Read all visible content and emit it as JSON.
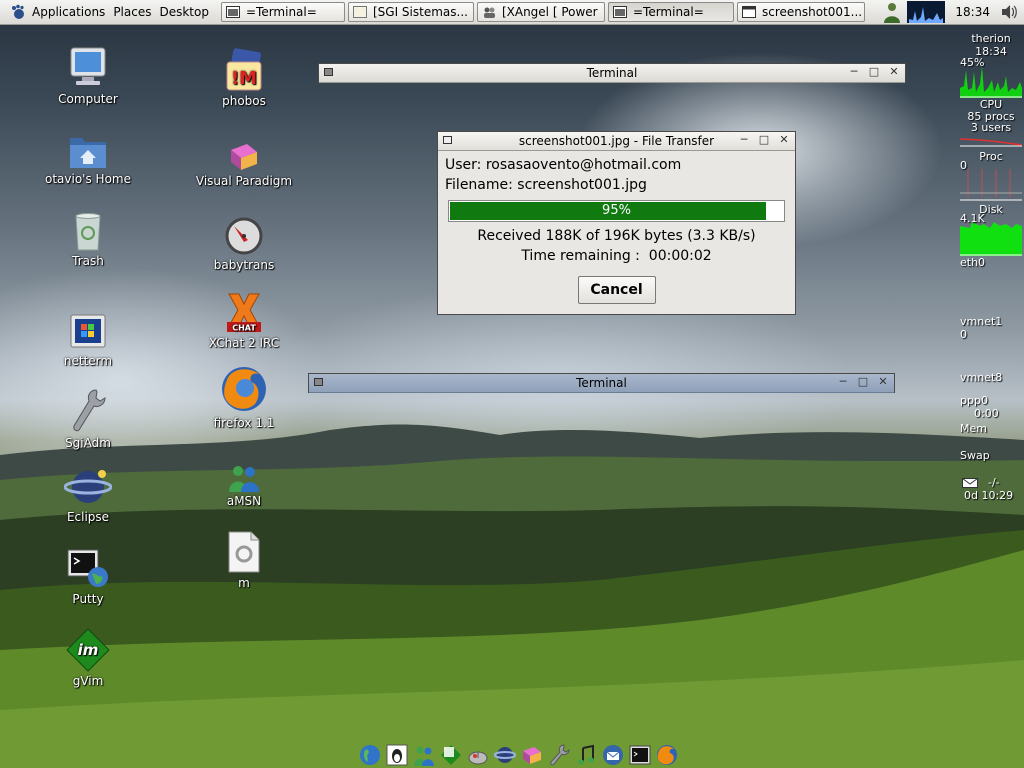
{
  "panel": {
    "applications": "Applications",
    "places": "Places",
    "desktop": "Desktop",
    "tasks": [
      {
        "label": "=Terminal=",
        "icon": "terminal-icon",
        "active": false
      },
      {
        "label": "[SGI Sistemas...",
        "icon": "chat-icon",
        "active": false
      },
      {
        "label": "[XAngel [ Power",
        "icon": "users-icon",
        "active": false
      },
      {
        "label": "=Terminal=",
        "icon": "terminal-icon",
        "active": true
      },
      {
        "label": "screenshot001...",
        "icon": "window-icon",
        "active": false
      }
    ],
    "clock": "18:34"
  },
  "desktop_icons_left": [
    {
      "label": "Computer",
      "icon": "computer-icon"
    },
    {
      "label": "otavio's Home",
      "icon": "home-folder-icon"
    },
    {
      "label": "Trash",
      "icon": "trash-icon"
    },
    {
      "label": "netterm",
      "icon": "netterm-icon"
    },
    {
      "label": "SgiAdm",
      "icon": "wrench-icon"
    },
    {
      "label": "Eclipse",
      "icon": "eclipse-icon"
    },
    {
      "label": "Putty",
      "icon": "putty-icon"
    },
    {
      "label": "gVim",
      "icon": "gvim-icon"
    }
  ],
  "desktop_icons_right": [
    {
      "label": "phobos",
      "icon": "phobos-icon"
    },
    {
      "label": "Visual Paradigm",
      "icon": "visual-paradigm-icon"
    },
    {
      "label": "babytrans",
      "icon": "babytrans-icon"
    },
    {
      "label": "XChat 2 IRC",
      "icon": "xchat-icon"
    },
    {
      "label": "firefox 1.1",
      "icon": "firefox-icon"
    },
    {
      "label": "aMSN",
      "icon": "amsn-icon"
    },
    {
      "label": "m",
      "icon": "document-icon"
    }
  ],
  "terminal_top": {
    "title": "Terminal"
  },
  "terminal_mid": {
    "title": "Terminal"
  },
  "file_transfer": {
    "title": "screenshot001.jpg - File Transfer",
    "user": "User: rosasaovento@hotmail.com",
    "filename": "Filename: screenshot001.jpg",
    "progress_label": "95%",
    "progress_fraction": 0.95,
    "received": "Received 188K of 196K bytes (3.3 KB/s)",
    "time_remaining": "Time remaining :  00:00:02",
    "cancel": "Cancel"
  },
  "monitor": {
    "host": "therion",
    "time": "18:34",
    "cpu_pct": "45%",
    "cpu": "CPU",
    "procs": "85 procs",
    "users": "3 users",
    "proc": "Proc",
    "proc_zero": "0",
    "disk": "Disk",
    "disk_rate": "4.1K",
    "eth0": "eth0",
    "vmnet1": "vmnet1",
    "vmnet1_val": "0",
    "vmnet8": "vmnet8",
    "ppp0": "ppp0",
    "ppp0_time": "0:00",
    "mem": "Mem",
    "swap": "Swap",
    "mail": "-/-",
    "uptime": "0d 10:29"
  },
  "dock": [
    "globe-icon",
    "tux-icon",
    "people-icon",
    "vim-icon",
    "mouse-icon",
    "eclipse-icon",
    "paradigm-icon",
    "wrench-icon",
    "music-icon",
    "thunderbird-icon",
    "terminal-icon",
    "firefox-icon"
  ],
  "colors": {
    "progress": "#107a10",
    "term_title_active": "#9aaac3"
  }
}
